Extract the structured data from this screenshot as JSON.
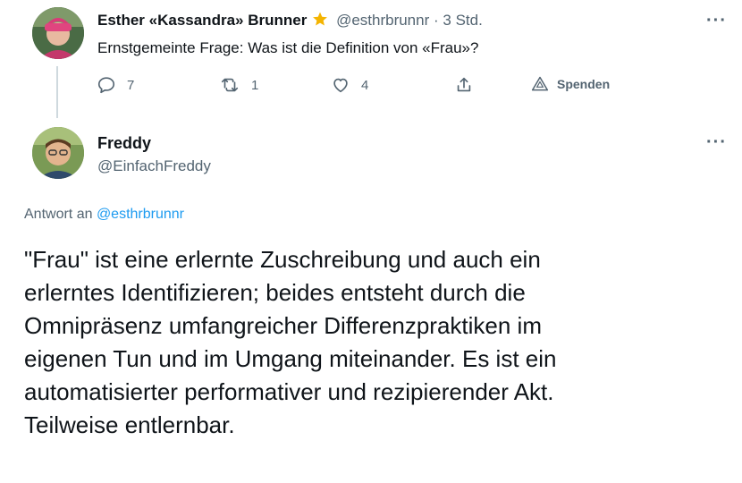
{
  "tweet1": {
    "name": "Esther «Kassandra» Brunner",
    "handle": "@esthrbrunnr",
    "separator": "·",
    "time": "3 Std.",
    "text": "Ernstgemeinte Frage: Was ist die Definition von «Frau»?",
    "replies": "7",
    "retweets": "1",
    "likes": "4",
    "donate_label": "Spenden",
    "more": "···"
  },
  "tweet2": {
    "name": "Freddy",
    "handle": "@EinfachFreddy",
    "more": "···",
    "reply_prefix": "Antwort an",
    "reply_handle": "@esthrbrunnr",
    "lines": [
      "\"Frau\" ist eine erlernte Zuschreibung und auch ein",
      "erlerntes Identifizieren; beides entsteht durch die",
      "Omnipräsenz umfangreicher Differenzpraktiken im",
      "eigenen Tun und im Umgang miteinander. Es ist ein",
      "automatisierter performativer und rezipierender Akt.",
      "Teilweise entlernbar."
    ]
  },
  "colors": {
    "text": "#0f1419",
    "secondary": "#536471",
    "link": "#1d9bf0",
    "star": "#f4b400"
  }
}
